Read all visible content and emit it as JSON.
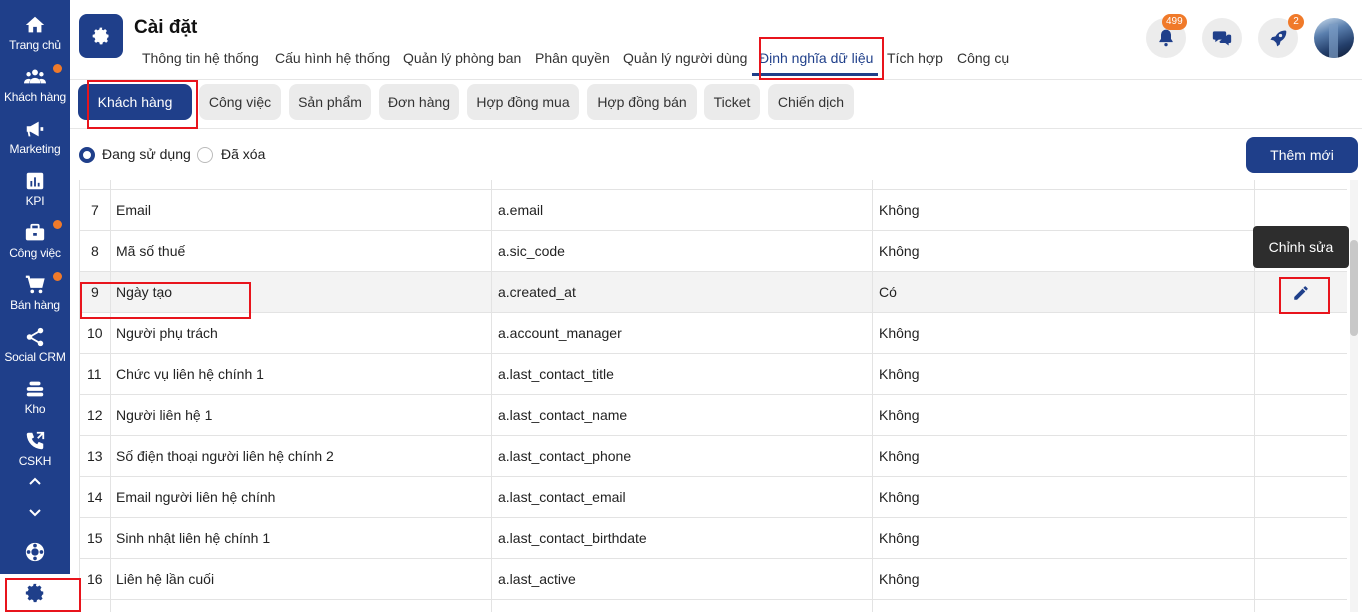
{
  "sidebar": {
    "items": [
      {
        "label": "Trang chủ",
        "icon": "home-icon"
      },
      {
        "label": "Khách hàng",
        "icon": "people-icon",
        "dot": true
      },
      {
        "label": "Marketing",
        "icon": "megaphone-icon"
      },
      {
        "label": "KPI",
        "icon": "chart-icon"
      },
      {
        "label": "Công việc",
        "icon": "briefcase-icon",
        "dot": true
      },
      {
        "label": "Bán hàng",
        "icon": "cart-icon",
        "dot": true
      },
      {
        "label": "Social CRM",
        "icon": "share-icon"
      },
      {
        "label": "Kho",
        "icon": "stack-icon"
      },
      {
        "label": "CSKH",
        "icon": "phone-icon"
      }
    ]
  },
  "header": {
    "title": "Cài đặt",
    "tabs": [
      {
        "label": "Thông tin hệ thống"
      },
      {
        "label": "Cấu hình hệ thống"
      },
      {
        "label": "Quản lý phòng ban"
      },
      {
        "label": "Phân quyền"
      },
      {
        "label": "Quản lý người dùng"
      },
      {
        "label": "Định nghĩa dữ liệu",
        "active": true
      },
      {
        "label": "Tích hợp"
      },
      {
        "label": "Công cụ"
      }
    ],
    "notification_count": "499",
    "rocket_count": "2"
  },
  "subtabs": [
    {
      "label": "Khách hàng",
      "active": true
    },
    {
      "label": "Công việc"
    },
    {
      "label": "Sản phẩm"
    },
    {
      "label": "Đơn hàng"
    },
    {
      "label": "Hợp đồng mua"
    },
    {
      "label": "Hợp đồng bán"
    },
    {
      "label": "Ticket"
    },
    {
      "label": "Chiến dịch"
    }
  ],
  "filters": {
    "active_label": "Đang sử dụng",
    "deleted_label": "Đã xóa",
    "selected": "Đang sử dụng"
  },
  "add_button": "Thêm mới",
  "tooltip": "Chỉnh sửa",
  "table": {
    "rows": [
      {
        "no": "7",
        "name": "Email",
        "field": "a.email",
        "required": "Không"
      },
      {
        "no": "8",
        "name": "Mã số thuế",
        "field": "a.sic_code",
        "required": "Không"
      },
      {
        "no": "9",
        "name": "Ngày tạo",
        "field": "a.created_at",
        "required": "Có",
        "highlighted": true
      },
      {
        "no": "10",
        "name": "Người phụ trách",
        "field": "a.account_manager",
        "required": "Không"
      },
      {
        "no": "11",
        "name": "Chức vụ liên hệ chính 1",
        "field": "a.last_contact_title",
        "required": "Không"
      },
      {
        "no": "12",
        "name": "Người liên hệ 1",
        "field": "a.last_contact_name",
        "required": "Không"
      },
      {
        "no": "13",
        "name": "Số điện thoại người liên hệ chính 2",
        "field": "a.last_contact_phone",
        "required": "Không"
      },
      {
        "no": "14",
        "name": "Email người liên hệ chính",
        "field": "a.last_contact_email",
        "required": "Không"
      },
      {
        "no": "15",
        "name": "Sinh nhật liên hệ chính 1",
        "field": "a.last_contact_birthdate",
        "required": "Không"
      },
      {
        "no": "16",
        "name": "Liên hệ lần cuối",
        "field": "a.last_active",
        "required": "Không"
      }
    ]
  },
  "colors": {
    "primary": "#1f3f8a",
    "accent_dot": "#f07a2a",
    "annotation_red": "#e8141c"
  }
}
